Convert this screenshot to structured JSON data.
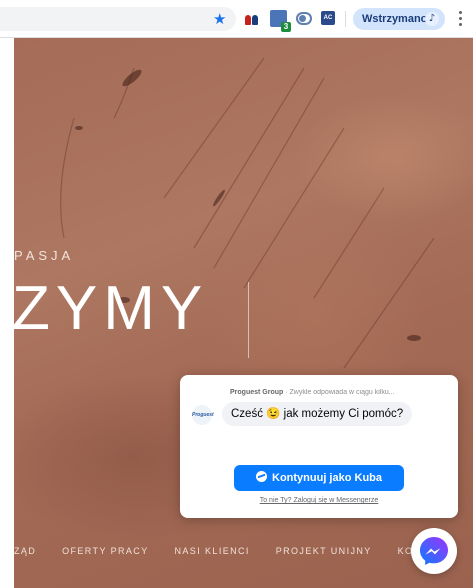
{
  "browser": {
    "paused_label": "Wstrzymano",
    "extensions": [
      {
        "name": "people-extension"
      },
      {
        "name": "translate-extension",
        "badge": "3"
      },
      {
        "name": "toggle-extension"
      },
      {
        "name": "ac-extension",
        "label": "AC"
      }
    ]
  },
  "hero": {
    "tagline": "PASJA",
    "headline": "ZYMY",
    "nav": [
      "ZĄD",
      "OFERTY PRACY",
      "NASI KLIENCI",
      "PROJEKT UNIJNY",
      "KONTAKT"
    ]
  },
  "chat": {
    "company": "Proguest Group",
    "reply_note": "· Zwykle odpowiada w ciągu kilku...",
    "avatar_text": "Proguest",
    "greeting": "Cześć 😉 jak możemy Ci pomóc?",
    "continue_label": "Kontynuuj jako Kuba",
    "login_link": "To nie Ty? Zaloguj się w Messengerze"
  },
  "colors": {
    "accent": "#0a7cff",
    "chip_bg": "#d2e3fc",
    "hero_bg": "#a8705a"
  }
}
